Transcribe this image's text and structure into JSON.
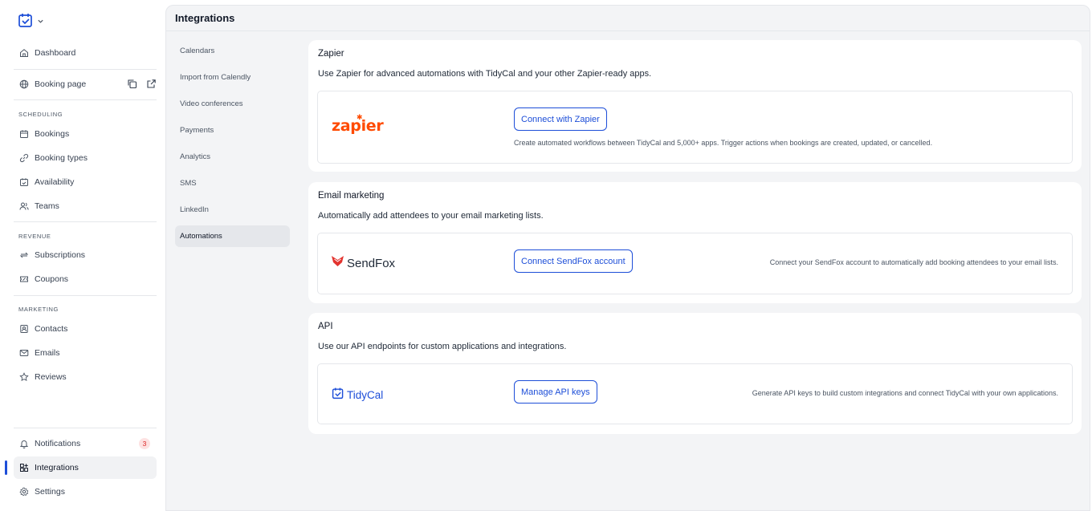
{
  "sidebar": {
    "top_items": [
      {
        "label": "Dashboard",
        "icon": "home-icon"
      },
      {
        "label": "Booking page",
        "icon": "globe-icon"
      }
    ],
    "scheduling_label": "SCHEDULING",
    "scheduling": [
      {
        "label": "Bookings",
        "icon": "calendar-icon"
      },
      {
        "label": "Booking types",
        "icon": "link-icon"
      },
      {
        "label": "Availability",
        "icon": "calendar-check-icon"
      },
      {
        "label": "Teams",
        "icon": "users-icon"
      }
    ],
    "revenue_label": "REVENUE",
    "revenue": [
      {
        "label": "Subscriptions",
        "icon": "refresh-icon"
      },
      {
        "label": "Coupons",
        "icon": "ticket-icon"
      }
    ],
    "marketing_label": "MARKETING",
    "marketing": [
      {
        "label": "Contacts",
        "icon": "contact-icon"
      },
      {
        "label": "Emails",
        "icon": "mail-icon"
      },
      {
        "label": "Reviews",
        "icon": "star-icon"
      }
    ],
    "bottom": [
      {
        "label": "Notifications",
        "icon": "bell-icon",
        "badge": "3"
      },
      {
        "label": "Integrations",
        "icon": "integrations-icon"
      },
      {
        "label": "Settings",
        "icon": "gear-icon"
      }
    ]
  },
  "header": {
    "title": "Integrations"
  },
  "subnav": [
    "Calendars",
    "Import from Calendly",
    "Video conferences",
    "Payments",
    "Analytics",
    "SMS",
    "LinkedIn",
    "Automations"
  ],
  "cards": {
    "zapier": {
      "title": "Zapier",
      "desc": "Use Zapier for advanced automations with TidyCal and your other Zapier-ready apps.",
      "brand": "zapier",
      "button": "Connect with Zapier",
      "info": "Create automated workflows between TidyCal and 5,000+ apps. Trigger actions when bookings are created, updated, or cancelled."
    },
    "email": {
      "title": "Email marketing",
      "desc": "Automatically add attendees to your email marketing lists.",
      "brand": "SendFox",
      "button": "Connect SendFox account",
      "info": "Connect your SendFox account to automatically add booking attendees to your email lists."
    },
    "api": {
      "title": "API",
      "desc": "Use our API endpoints for custom applications and integrations.",
      "brand": "TidyCal",
      "button": "Manage API keys",
      "info": "Generate API keys to build custom integrations and connect TidyCal with your own applications."
    }
  },
  "colors": {
    "accent": "#1d4ed8",
    "zapier": "#ff4a00",
    "sendfox": "#e3342f",
    "badge": "#dc2626"
  }
}
